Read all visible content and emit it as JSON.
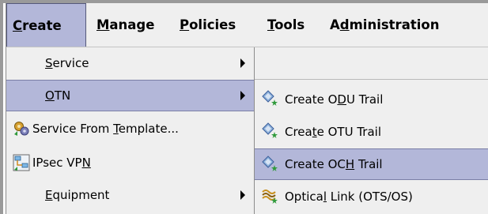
{
  "menubar": {
    "items": [
      {
        "pre": "",
        "u": "C",
        "post": "reate"
      },
      {
        "pre": "",
        "u": "M",
        "post": "anage"
      },
      {
        "pre": "",
        "u": "P",
        "post": "olicies"
      },
      {
        "pre": "",
        "u": "T",
        "post": "ools"
      },
      {
        "pre": "A",
        "u": "d",
        "post": "ministration"
      }
    ]
  },
  "create_menu": {
    "items": [
      {
        "pre": "",
        "u": "S",
        "post": "ervice"
      },
      {
        "pre": "",
        "u": "O",
        "post": "TN"
      },
      {
        "pre": "Service From ",
        "u": "T",
        "post": "emplate..."
      },
      {
        "pre": "IPsec VP",
        "u": "N",
        "post": ""
      },
      {
        "pre": "",
        "u": "E",
        "post": "quipment"
      }
    ]
  },
  "otn_menu": {
    "items": [
      {
        "pre": "Create O",
        "u": "D",
        "post": "U Trail"
      },
      {
        "pre": "Crea",
        "u": "t",
        "post": "e OTU Trail"
      },
      {
        "pre": "Create OC",
        "u": "H",
        "post": " Trail"
      },
      {
        "pre": "Optica",
        "u": "l",
        "post": " Link (OTS/OS)"
      }
    ]
  },
  "icons": {
    "service_from_template": "template-gears-icon",
    "ipsec_vpn": "vpn-network-icon",
    "trail": "trail-diamond-star-icon",
    "optical_link": "optical-link-wave-icon"
  },
  "colors": {
    "highlight": "#b3b7d9",
    "menu_bg": "#efefef"
  }
}
